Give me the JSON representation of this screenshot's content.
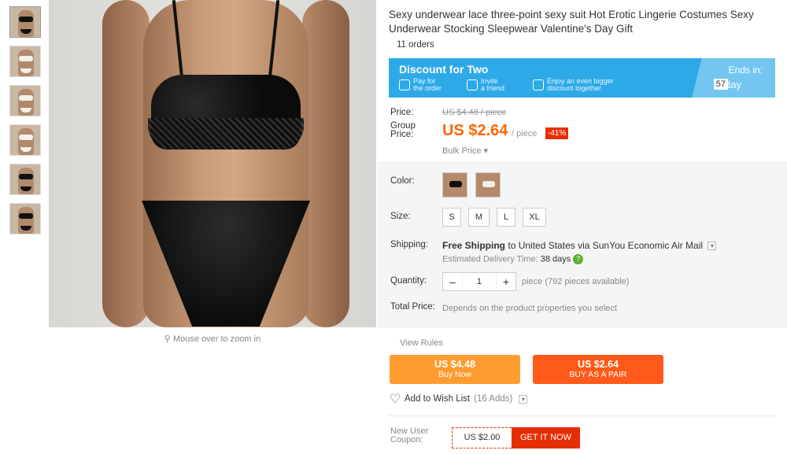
{
  "gallery": {
    "thumbnails": [
      "thumb-1",
      "thumb-2",
      "thumb-3",
      "thumb-4",
      "thumb-5",
      "thumb-6"
    ],
    "zoom_hint": "Mouse over to zoom in"
  },
  "product": {
    "title": "Sexy underwear lace three-point sexy suit Hot Erotic Lingerie Costumes Sexy Underwear Stocking Sleepwear Valentine's Day Gift",
    "orders": "11 orders"
  },
  "promo": {
    "title": "Discount for Two",
    "items": [
      {
        "label": "Pay for the order",
        "line1": "Pay for",
        "line2": "the order"
      },
      {
        "label": "Invite a friend",
        "line1": "Invite",
        "line2": "a friend"
      },
      {
        "label": "Enjoy an even bigger discount together",
        "line1": "Enjoy an even bigger",
        "line2": "discount together"
      }
    ],
    "ends_label": "Ends in:",
    "ends_days": "57",
    "ends_unit": "day"
  },
  "pricing": {
    "price_label": "Price:",
    "old_price": "US $4.48 / piece",
    "group_label_1": "Group",
    "group_label_2": "Price:",
    "group_price": "US $2.64",
    "per_unit": "/ piece",
    "discount": "-41%",
    "bulk": "Bulk Price ▾"
  },
  "attributes": {
    "color_label": "Color:",
    "size_label": "Size:",
    "sizes": [
      "S",
      "M",
      "L",
      "XL"
    ],
    "shipping_label": "Shipping:",
    "shipping_free": "Free Shipping",
    "shipping_rest": "to United States via SunYou Economic Air Mail",
    "est_label": "Estimated Delivery Time:",
    "est_days": "38 days",
    "quantity_label": "Quantity:",
    "quantity": "1",
    "quantity_minus": "–",
    "quantity_plus": "+",
    "availability": "piece (792 pieces available)",
    "total_label": "Total Price:",
    "total_value": "Depends on the product properties you select"
  },
  "actions": {
    "view_rules": "View Rules",
    "buy_now_price": "US $4.48",
    "buy_now_label": "Buy Now",
    "buy_pair_price": "US $2.64",
    "buy_pair_label": "BUY AS A PAIR",
    "wish_label": "Add to Wish List",
    "wish_count": "(16 Adds)",
    "coupon_label_1": "New User",
    "coupon_label_2": "Coupon:",
    "coupon_value": "US $2.00",
    "coupon_button": "GET IT NOW"
  },
  "colors": {
    "accent_orange": "#ff6600",
    "buy_now_bg": "#ff9c30",
    "buy_pair_bg": "#ff5a1a",
    "promo_blue": "#2ea9e8",
    "discount_red": "#e62e04"
  }
}
